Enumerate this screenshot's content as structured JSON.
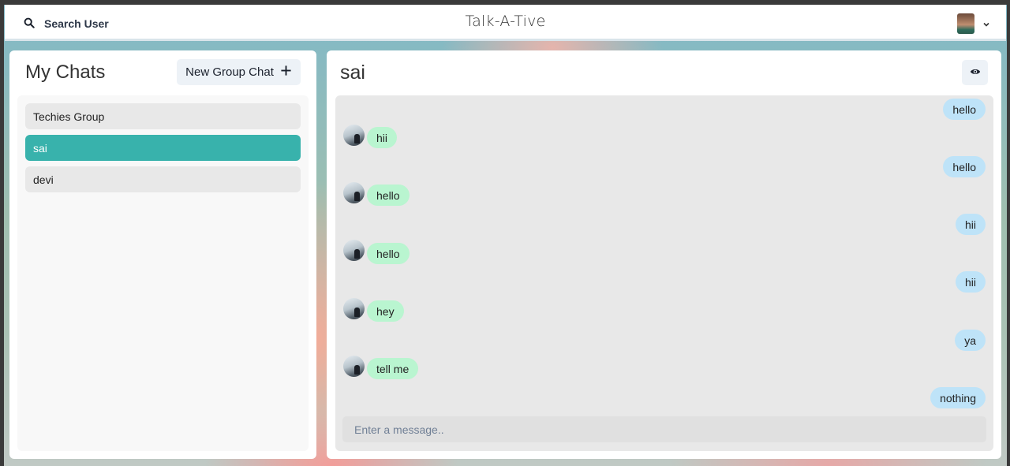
{
  "header": {
    "search_label": "Search User",
    "app_title": "Talk-A-Tive"
  },
  "sidebar": {
    "title": "My Chats",
    "new_group_label": "New Group Chat",
    "chats": [
      {
        "name": "Techies Group",
        "active": false
      },
      {
        "name": "sai",
        "active": true
      },
      {
        "name": "devi",
        "active": false
      }
    ]
  },
  "chat": {
    "name": "sai",
    "messages": [
      {
        "text": "hello",
        "direction": "sent"
      },
      {
        "text": "hii",
        "direction": "received"
      },
      {
        "text": "hello",
        "direction": "sent"
      },
      {
        "text": "hello",
        "direction": "received"
      },
      {
        "text": "hii",
        "direction": "sent"
      },
      {
        "text": "hello",
        "direction": "received"
      },
      {
        "text": "hii",
        "direction": "sent"
      },
      {
        "text": "hey",
        "direction": "received"
      },
      {
        "text": "ya",
        "direction": "sent"
      },
      {
        "text": "tell me",
        "direction": "received"
      },
      {
        "text": "nothing",
        "direction": "sent"
      }
    ],
    "input_placeholder": "Enter a message.."
  },
  "colors": {
    "accent": "#38b2ac",
    "sent_bubble": "#bee3f8",
    "received_bubble": "#b9f5d0"
  },
  "icons": {
    "search": "search-icon",
    "add": "plus-icon",
    "view": "eye-icon",
    "dropdown": "chevron-down-icon"
  }
}
